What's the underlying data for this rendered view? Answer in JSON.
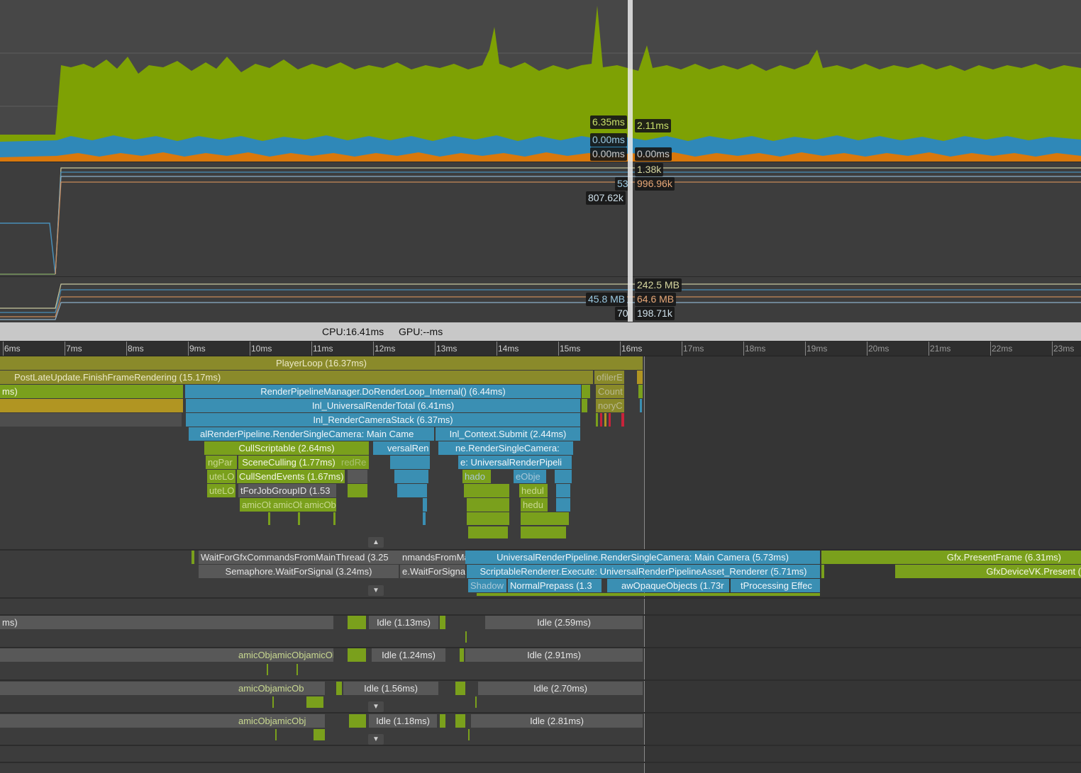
{
  "cpu_chart": {
    "tooltips_left": [
      "6.35ms",
      "0.00ms",
      "0.00ms"
    ],
    "tooltips_right": [
      "2.11ms",
      "0.00ms"
    ],
    "colors": {
      "scripts": "#7ea104",
      "rendering": "#2f88b8",
      "physics": "#d9780c",
      "background": "#474747"
    }
  },
  "render_chart": {
    "tooltips_left": [
      "53",
      "807.62k"
    ],
    "tooltips_right": [
      "1.38k",
      "996.96k"
    ]
  },
  "memory_chart": {
    "tooltips_left": [
      "45.8 MB",
      "70"
    ],
    "tooltips_right": [
      "242.5 MB",
      "64.6 MB",
      "198.71k"
    ]
  },
  "status": {
    "cpu": "CPU:16.41ms",
    "gpu": "GPU:--ms"
  },
  "ruler": {
    "ticks": [
      "6ms",
      "7ms",
      "8ms",
      "9ms",
      "10ms",
      "11ms",
      "12ms",
      "13ms",
      "14ms",
      "15ms",
      "16ms",
      "17ms",
      "18ms",
      "19ms",
      "20ms",
      "21ms",
      "22ms",
      "23ms"
    ]
  },
  "main_thread": {
    "player_loop": "PlayerLoop (16.37ms)",
    "post_late_update": "PostLateUpdate.FinishFrameRendering (15.17ms)",
    "profiler_short": "ofilerE",
    "ms_cut": "ms)",
    "do_render_loop": "RenderPipelineManager.DoRenderLoop_Internal() (6.44ms)",
    "count_short": "Count",
    "render_total": "Inl_UniversalRenderTotal (6.41ms)",
    "memory_short": "noryC",
    "camera_stack": "Inl_RenderCameraStack (6.37ms)",
    "single_camera_cut": "alRenderPipeline.RenderSingleCamera: Main Came",
    "context_submit": "Inl_Context.Submit (2.44ms)",
    "cull_scriptable": "CullScriptable (2.64ms)",
    "versal_ren": "versalRen",
    "render_single_cut": "ne.RenderSingleCamera:",
    "ng_par": "ngPar",
    "scene_culling": "SceneCulling (1.77ms)",
    "red_re": "redRe",
    "universal_pipeline_cut": "e: UniversalRenderPipeli",
    "ute_lo": "uteLO",
    "cull_send_events": "CullSendEvents (1.67ms)",
    "shado": "hado",
    "e_obje": "eObje",
    "ute_lo2": "uteLO",
    "wait_job_group": "tForJobGroupID (1.53",
    "hedul": "hedul",
    "amic_obj_1": "amicOb",
    "amic_obj_2": "amicOb",
    "amic_obj_3": "amicOb",
    "hedu2": "hedu"
  },
  "render_thread": {
    "wait_gfx": "WaitForGfxCommandsFromMainThread (3.25",
    "mands_from": "nmandsFromMa",
    "universal_camera": "UniversalRenderPipeline.RenderSingleCamera: Main Camera (5.73ms)",
    "present_frame": "Gfx.PresentFrame (6.31ms)",
    "semaphore": "Semaphore.WaitForSignal (3.24ms)",
    "wait_for_signa": "e.WaitForSigna",
    "renderer_execute": "ScriptableRenderer.Execute: UniversalRenderPipelineAsset_Renderer (5.71ms)",
    "device_present": "GfxDeviceVK.Present (",
    "shadow": "Shadow",
    "normal_prepass": "NormalPrepass (1.3",
    "opaque_objects": "awOpaqueObjects (1.73r",
    "post_processing": "tProcessing Effec"
  },
  "worker_threads": [
    {
      "cut": "ms)",
      "idle_a": "Idle (1.13ms)",
      "idle_b": "Idle (2.59ms)"
    },
    {
      "cut": "amicObjamicObjamicObj",
      "idle_a": "Idle (1.24ms)",
      "idle_b": "Idle (2.91ms)"
    },
    {
      "cut": "amicObjamicOb",
      "idle_a": "Idle (1.56ms)",
      "idle_b": "Idle (2.70ms)"
    },
    {
      "cut": "amicObjamicObj",
      "idle_a": "Idle (1.18ms)",
      "idle_b": "Idle (2.81ms)"
    }
  ],
  "icons": {
    "collapse": "chevron-up-icon",
    "expand": "chevron-down-icon"
  }
}
